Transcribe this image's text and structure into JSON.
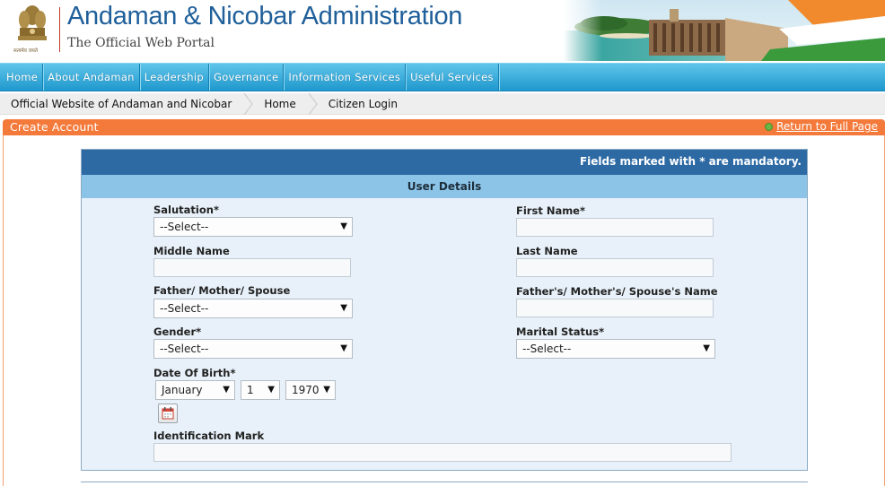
{
  "header": {
    "title": "Andaman & Nicobar Administration",
    "subtitle": "The Official Web Portal",
    "emblem_caption": "सत्यमेव जयते"
  },
  "nav": {
    "items": [
      {
        "label": "Home"
      },
      {
        "label": "About Andaman"
      },
      {
        "label": "Leadership"
      },
      {
        "label": "Governance"
      },
      {
        "label": "Information Services"
      },
      {
        "label": "Useful Services"
      }
    ]
  },
  "breadcrumb": {
    "items": [
      {
        "label": "Official Website of Andaman and Nicobar"
      },
      {
        "label": "Home"
      },
      {
        "label": "Citizen Login"
      }
    ]
  },
  "page": {
    "title": "Create Account",
    "return_link": "Return to Full Page"
  },
  "form": {
    "mandatory_note": "Fields marked with * are mandatory.",
    "section_title": "User Details",
    "salutation": {
      "label": "Salutation*",
      "value": "--Select--"
    },
    "first_name": {
      "label": "First Name*",
      "value": ""
    },
    "middle_name": {
      "label": "Middle Name",
      "value": ""
    },
    "last_name": {
      "label": "Last Name",
      "value": ""
    },
    "relation": {
      "label": "Father/ Mother/ Spouse",
      "value": "--Select--"
    },
    "relation_name": {
      "label": "Father's/ Mother's/ Spouse's Name",
      "value": ""
    },
    "gender": {
      "label": "Gender*",
      "value": "--Select--"
    },
    "marital_status": {
      "label": "Marital Status*",
      "value": "--Select--"
    },
    "dob": {
      "label": "Date Of Birth*",
      "month": "January",
      "day": "1",
      "year": "1970"
    },
    "identification_mark": {
      "label": "Identification Mark",
      "value": ""
    }
  },
  "colors": {
    "title_blue": "#1f5f9a",
    "nav_blue": "#1f98cd",
    "orange": "#f47a3b",
    "panel_head": "#2d6aa4",
    "section_head": "#8cc4e8"
  },
  "icons": {
    "emblem": "national-emblem-icon",
    "calendar": "calendar-icon",
    "return": "green-bullet-icon"
  }
}
